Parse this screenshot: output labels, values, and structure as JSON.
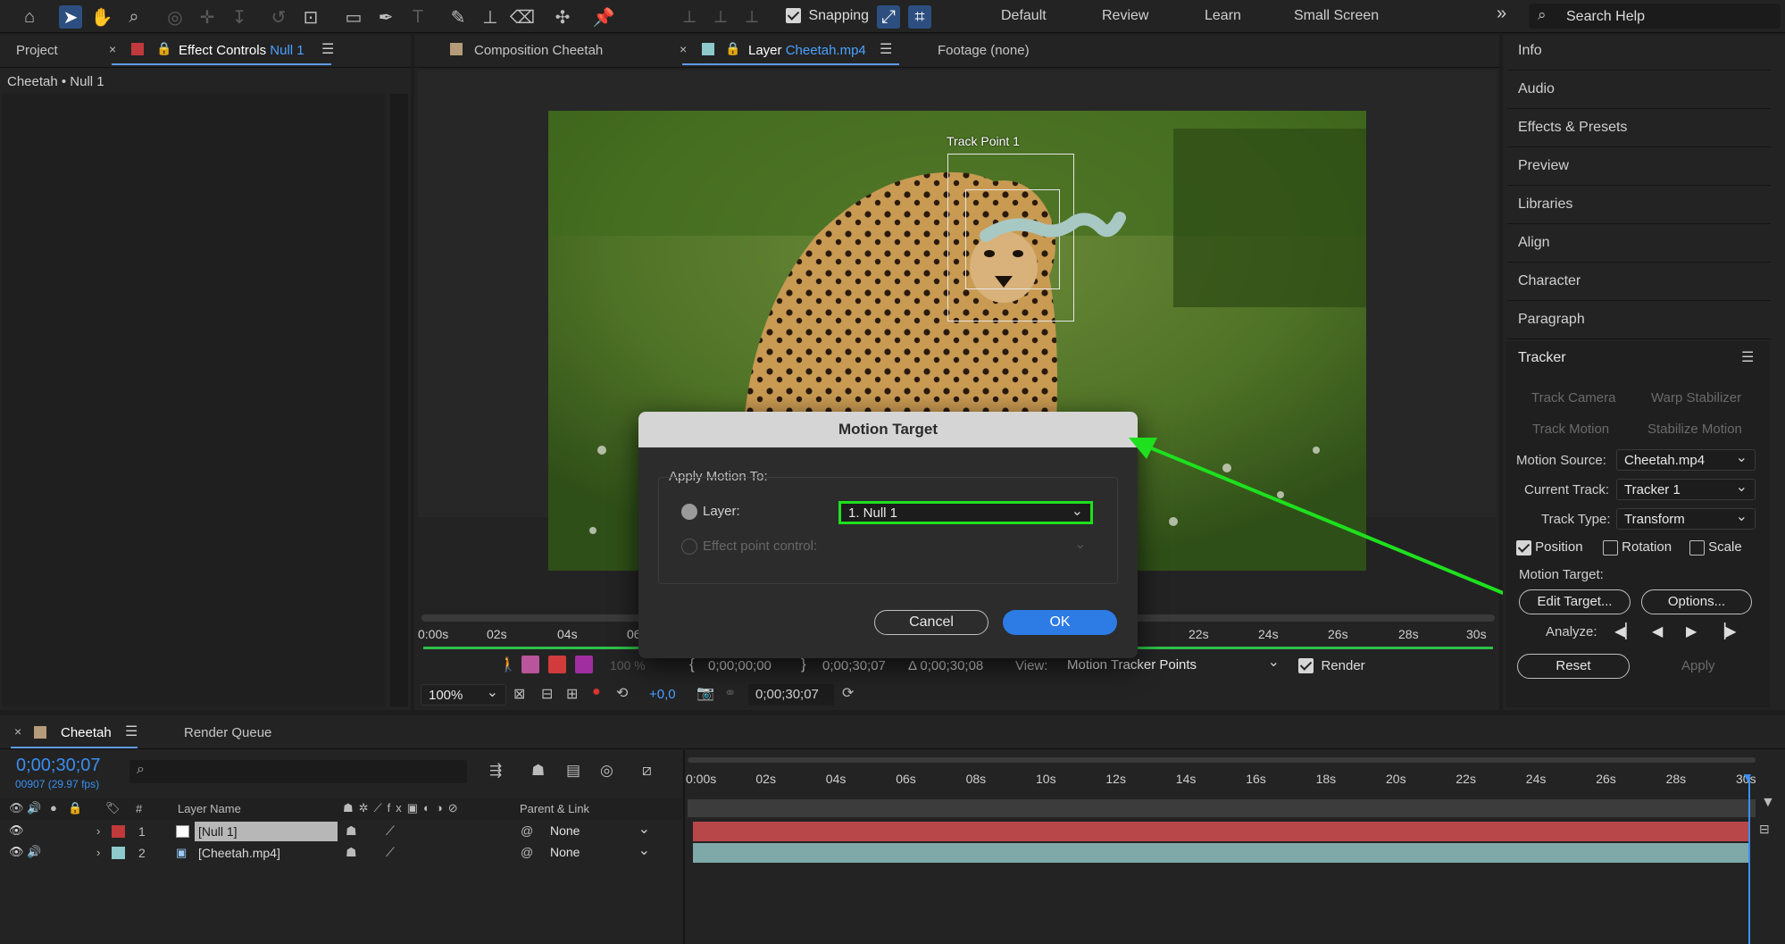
{
  "toolbar": {
    "snapping_label": "Snapping",
    "workspaces": [
      "Default",
      "Review",
      "Learn",
      "Small Screen"
    ],
    "overflow": "»",
    "search_placeholder": "Search Help"
  },
  "left_panel": {
    "tab_project": "Project",
    "tab_effect_controls": "Effect Controls",
    "tab_effect_controls_target": "Null 1",
    "breadcrumb": "Cheetah • Null 1"
  },
  "viewer": {
    "tab_composition": "Composition Cheetah",
    "tab_layer": "Layer",
    "tab_layer_target": "Cheetah.mp4",
    "tab_footage": "Footage (none)",
    "track_point_label": "Track Point 1",
    "ruler_labels": [
      "0:00s",
      "02s",
      "04s",
      "06s",
      "22s",
      "24s",
      "26s",
      "28s",
      "30s"
    ],
    "zoom_pct": "100 %",
    "in_point": "0;00;00;00",
    "out_point": "0;00;30;07",
    "duration": "Δ 0;00;30;08",
    "view_label": "View:",
    "view_value": "Motion Tracker Points",
    "render_label": "Render",
    "magnification": "100%",
    "exposure": "+0,0",
    "current_time": "0;00;30;07"
  },
  "dialog": {
    "title": "Motion Target",
    "group_label": "Apply Motion To:",
    "layer_label": "Layer:",
    "layer_value": "1. Null 1",
    "effect_point_label": "Effect point control:",
    "cancel_label": "Cancel",
    "ok_label": "OK"
  },
  "right_panel": {
    "items": [
      "Info",
      "Audio",
      "Effects & Presets",
      "Preview",
      "Libraries",
      "Align",
      "Character",
      "Paragraph"
    ],
    "tracker": {
      "title": "Tracker",
      "track_camera": "Track Camera",
      "warp_stabilizer": "Warp Stabilizer",
      "track_motion": "Track Motion",
      "stabilize_motion": "Stabilize Motion",
      "motion_source_label": "Motion Source:",
      "motion_source_value": "Cheetah.mp4",
      "current_track_label": "Current Track:",
      "current_track_value": "Tracker 1",
      "track_type_label": "Track Type:",
      "track_type_value": "Transform",
      "position_label": "Position",
      "rotation_label": "Rotation",
      "scale_label": "Scale",
      "motion_target_label": "Motion Target:",
      "edit_target_label": "Edit Target...",
      "options_label": "Options...",
      "analyze_label": "Analyze:",
      "reset_label": "Reset",
      "apply_label": "Apply"
    }
  },
  "timeline": {
    "tab_comp": "Cheetah",
    "tab_render_queue": "Render Queue",
    "timecode": "0;00;30;07",
    "frame_info": "00907 (29.97 fps)",
    "col_hash": "#",
    "col_layer_name": "Layer Name",
    "col_parent": "Parent & Link",
    "layers": [
      {
        "num": "1",
        "name": "[Null 1]",
        "parent": "None",
        "color": "#c0393b"
      },
      {
        "num": "2",
        "name": "[Cheetah.mp4]",
        "parent": "None",
        "color": "#8ec9cc"
      }
    ],
    "ruler": [
      "0:00s",
      "02s",
      "04s",
      "06s",
      "08s",
      "10s",
      "12s",
      "14s",
      "16s",
      "18s",
      "20s",
      "22s",
      "24s",
      "26s",
      "28s",
      "30s"
    ]
  },
  "colors": {
    "accent_blue": "#2d7be5",
    "highlight_green": "#1ee01e",
    "null_layer_red": "#b8474a",
    "footage_teal": "#7fa8a8"
  }
}
